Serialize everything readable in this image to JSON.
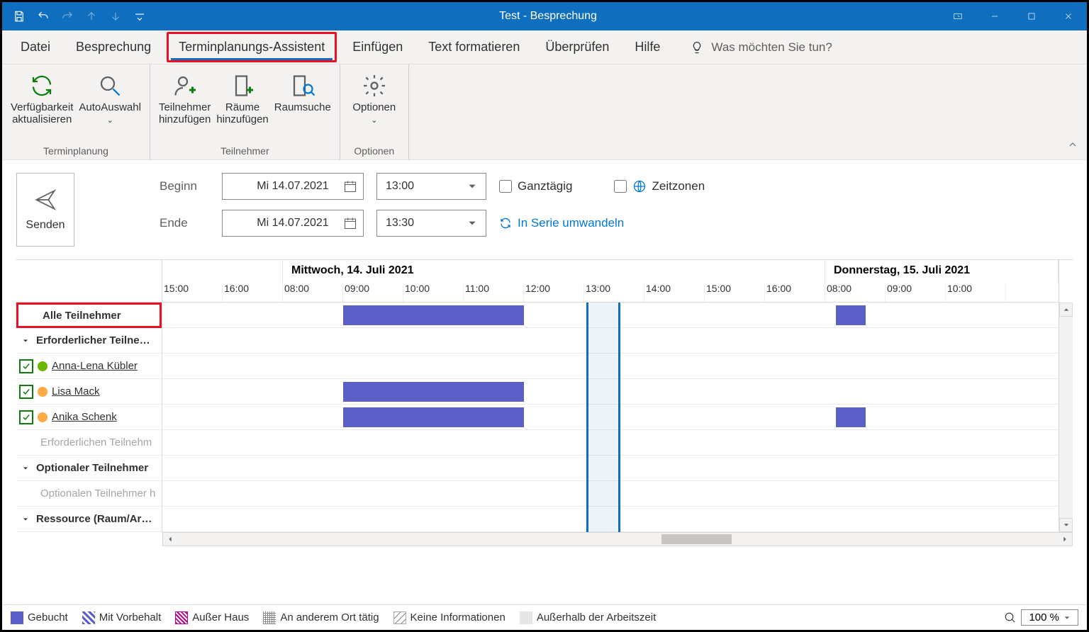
{
  "window": {
    "title": "Test  -  Besprechung"
  },
  "tabs": [
    "Datei",
    "Besprechung",
    "Terminplanungs-Assistent",
    "Einfügen",
    "Text formatieren",
    "Überprüfen",
    "Hilfe"
  ],
  "active_tab_index": 2,
  "tell_me": "Was möchten Sie tun?",
  "ribbon": {
    "groups": [
      {
        "label": "Terminplanung",
        "buttons": [
          {
            "icon": "refresh",
            "label": "Verfügbarkeit\naktualisieren"
          },
          {
            "icon": "autopick",
            "label": "AutoAuswahl",
            "dropdown": true
          }
        ]
      },
      {
        "label": "Teilnehmer",
        "buttons": [
          {
            "icon": "add-attendee",
            "label": "Teilnehmer\nhinzufügen"
          },
          {
            "icon": "add-room",
            "label": "Räume\nhinzufügen"
          },
          {
            "icon": "room-finder",
            "label": "Raumsuche"
          }
        ]
      },
      {
        "label": "Optionen",
        "buttons": [
          {
            "icon": "gear",
            "label": "Optionen",
            "dropdown": true
          }
        ]
      }
    ]
  },
  "send_label": "Senden",
  "datetime": {
    "begin_label": "Beginn",
    "end_label": "Ende",
    "begin_date": "Mi 14.07.2021",
    "begin_time": "13:00",
    "end_date": "Mi 14.07.2021",
    "end_time": "13:30",
    "allday_label": "Ganztägig",
    "timezones_label": "Zeitzonen",
    "recurring_label": "In Serie umwandeln"
  },
  "scheduler": {
    "day_headers": [
      "Mittwoch, 14. Juli 2021",
      "Donnerstag, 15. Juli 2021"
    ],
    "time_slots": [
      "15:00",
      "16:00",
      "08:00",
      "09:00",
      "10:00",
      "11:00",
      "12:00",
      "13:00",
      "14:00",
      "15:00",
      "16:00",
      "08:00",
      "09:00",
      "10:00"
    ],
    "all_attendees": "Alle Teilnehmer",
    "sections": {
      "required": "Erforderlicher Teilne…",
      "optional": "Optionaler Teilnehmer",
      "resource": "Ressource (Raum/Ar…"
    },
    "attendees": [
      {
        "name": "Anna-Lena Kübler",
        "status": "free"
      },
      {
        "name": "Lisa Mack",
        "status": "away"
      },
      {
        "name": "Anika Schenk",
        "status": "away"
      }
    ],
    "placeholder_required": "Erforderlichen Teilnehm",
    "placeholder_optional": "Optionalen Teilnehmer h"
  },
  "legend": {
    "busy": "Gebucht",
    "tentative": "Mit Vorbehalt",
    "oof": "Außer Haus",
    "elsewhere": "An anderem Ort tätig",
    "noinfo": "Keine Informationen",
    "outside": "Außerhalb der Arbeitszeit"
  },
  "zoom": "100 %"
}
